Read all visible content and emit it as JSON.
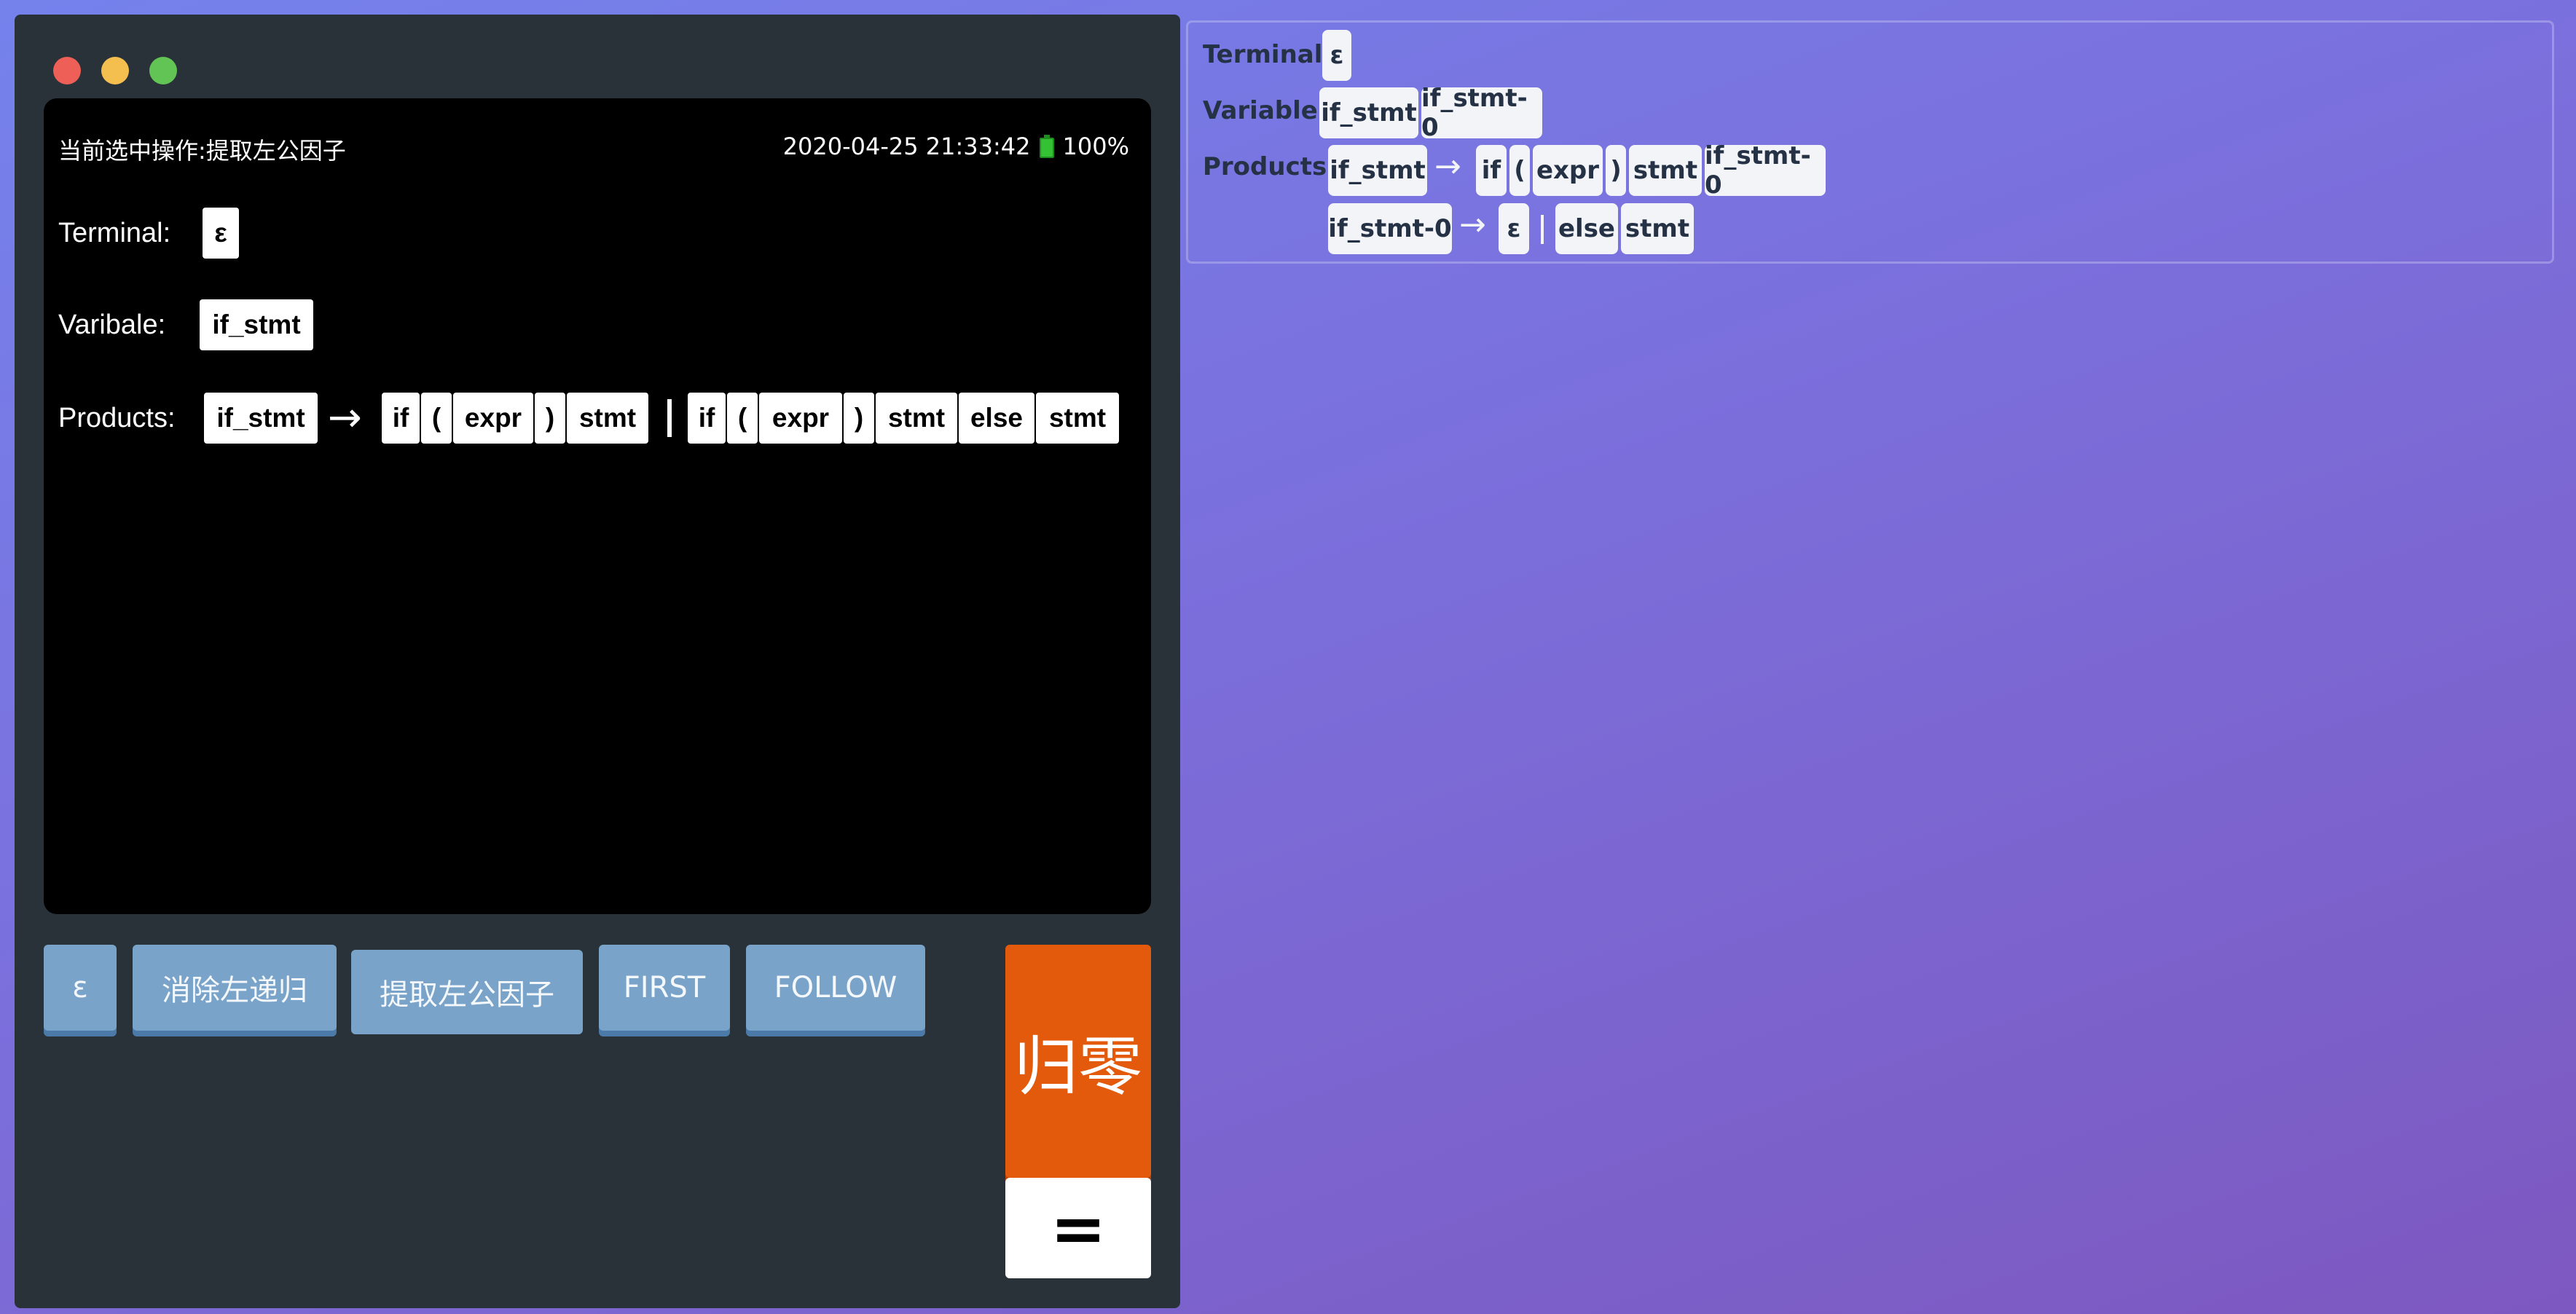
{
  "window": {
    "status": {
      "operation": "当前选中操作:提取左公因子",
      "datetime": "2020-04-25 21:33:42",
      "battery": "100%"
    },
    "screen": {
      "terminal_label": "Terminal:",
      "terminal_tokens": [
        "ε"
      ],
      "variable_label": "Varibale:",
      "variable_tokens": [
        "if_stmt"
      ],
      "products_label": "Products:",
      "product": {
        "head": "if_stmt",
        "arrow": "→",
        "alt1": [
          "if",
          "(",
          "expr",
          ")",
          "stmt"
        ],
        "alt2": [
          "if",
          "(",
          "expr",
          ")",
          "stmt",
          "else",
          "stmt"
        ]
      }
    },
    "keys": {
      "epsilon": "ε",
      "eliminate_left_recursion": "消除左递归",
      "extract_left_factor": "提取左公因子",
      "first": "FIRST",
      "follow": "FOLLOW",
      "reset": "归零",
      "equals": "="
    }
  },
  "panel": {
    "terminal_label": "Terminal:",
    "terminal_tokens": [
      "ε"
    ],
    "variable_label": "Variable:",
    "variable_tokens": [
      "if_stmt",
      "if_stmt-0"
    ],
    "products_label": "Products:",
    "product1": {
      "head": "if_stmt",
      "arrow": "→",
      "body": [
        "if",
        "(",
        "expr",
        ")",
        "stmt",
        "if_stmt-0"
      ]
    },
    "product2": {
      "head": "if_stmt-0",
      "arrow": "→",
      "alt1": [
        "ε"
      ],
      "alt2": [
        "else",
        "stmt"
      ]
    }
  }
}
